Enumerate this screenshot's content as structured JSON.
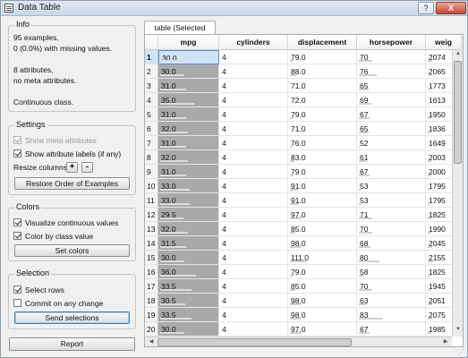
{
  "window": {
    "title": "Data Table",
    "help_label": "?",
    "close_label": "X"
  },
  "info": {
    "title": "Info",
    "lines": [
      "95 examples,",
      "0 (0.0%) with missing values.",
      "8 attributes,",
      "no meta attributes.",
      "Continuous class."
    ]
  },
  "settings": {
    "title": "Settings",
    "show_meta": {
      "label": "Show meta attributes",
      "checked": true,
      "enabled": false
    },
    "show_labels": {
      "label": "Show attribute labels (if any)",
      "checked": true,
      "enabled": true
    },
    "resize_label": "Resize columns:",
    "plus_label": "+",
    "minus_label": "-",
    "restore_label": "Restore Order of Examples"
  },
  "colors": {
    "title": "Colors",
    "visualize": {
      "label": "Visualize continuous values",
      "checked": true
    },
    "color_by_class": {
      "label": "Color by class value",
      "checked": true
    },
    "set_colors_label": "Set colors"
  },
  "selection": {
    "title": "Selection",
    "select_rows": {
      "label": "Select rows",
      "checked": true
    },
    "commit": {
      "label": "Commit on any change",
      "checked": false
    },
    "send_label": "Send selections"
  },
  "report_label": "Report",
  "tab_label": "table (Selected Data)",
  "table": {
    "columns": [
      "mpg",
      "cylinders",
      "displacement",
      "horsepower",
      "weig"
    ],
    "rows": [
      {
        "n": "1",
        "mpg": "30.0",
        "cyl": "4",
        "disp": "79.0",
        "hp": "70",
        "weight": "2074",
        "bars": [
          0.42,
          0.0,
          0.05,
          0.2,
          0.15
        ]
      },
      {
        "n": "2",
        "mpg": "30.0",
        "cyl": "4",
        "disp": "88.0",
        "hp": "76",
        "weight": "2065",
        "bars": [
          0.42,
          0.0,
          0.1,
          0.28,
          0.15
        ]
      },
      {
        "n": "3",
        "mpg": "31.0",
        "cyl": "4",
        "disp": "71.0",
        "hp": "65",
        "weight": "1773",
        "bars": [
          0.45,
          0.0,
          0.0,
          0.15,
          0.05
        ]
      },
      {
        "n": "4",
        "mpg": "35.0",
        "cyl": "4",
        "disp": "72.0",
        "hp": "69",
        "weight": "1613",
        "bars": [
          0.6,
          0.0,
          0.0,
          0.19,
          0.02
        ]
      },
      {
        "n": "5",
        "mpg": "31.0",
        "cyl": "4",
        "disp": "79.0",
        "hp": "67",
        "weight": "1950",
        "bars": [
          0.45,
          0.0,
          0.05,
          0.17,
          0.1
        ]
      },
      {
        "n": "6",
        "mpg": "32.0",
        "cyl": "4",
        "disp": "71.0",
        "hp": "65",
        "weight": "1836",
        "bars": [
          0.48,
          0.0,
          0.0,
          0.15,
          0.07
        ]
      },
      {
        "n": "7",
        "mpg": "31.0",
        "cyl": "4",
        "disp": "76.0",
        "hp": "52",
        "weight": "1649",
        "bars": [
          0.45,
          0.0,
          0.03,
          0.02,
          0.02
        ]
      },
      {
        "n": "8",
        "mpg": "32.0",
        "cyl": "4",
        "disp": "83.0",
        "hp": "61",
        "weight": "2003",
        "bars": [
          0.48,
          0.0,
          0.07,
          0.11,
          0.11
        ]
      },
      {
        "n": "9",
        "mpg": "31.0",
        "cyl": "4",
        "disp": "79.0",
        "hp": "67",
        "weight": "2000",
        "bars": [
          0.45,
          0.0,
          0.05,
          0.17,
          0.11
        ]
      },
      {
        "n": "10",
        "mpg": "33.0",
        "cyl": "4",
        "disp": "91.0",
        "hp": "53",
        "weight": "1795",
        "bars": [
          0.52,
          0.0,
          0.12,
          0.03,
          0.06
        ]
      },
      {
        "n": "11",
        "mpg": "33.0",
        "cyl": "4",
        "disp": "91.0",
        "hp": "53",
        "weight": "1795",
        "bars": [
          0.52,
          0.0,
          0.12,
          0.03,
          0.06
        ]
      },
      {
        "n": "12",
        "mpg": "29.5",
        "cyl": "4",
        "disp": "97.0",
        "hp": "71",
        "weight": "1825",
        "bars": [
          0.4,
          0.0,
          0.16,
          0.21,
          0.07
        ]
      },
      {
        "n": "13",
        "mpg": "32.0",
        "cyl": "4",
        "disp": "85.0",
        "hp": "70",
        "weight": "1990",
        "bars": [
          0.48,
          0.0,
          0.08,
          0.2,
          0.1
        ]
      },
      {
        "n": "14",
        "mpg": "31.5",
        "cyl": "4",
        "disp": "98.0",
        "hp": "68",
        "weight": "2045",
        "bars": [
          0.46,
          0.0,
          0.17,
          0.18,
          0.13
        ]
      },
      {
        "n": "15",
        "mpg": "30.0",
        "cyl": "4",
        "disp": "111.0",
        "hp": "80",
        "weight": "2155",
        "bars": [
          0.42,
          0.0,
          0.25,
          0.32,
          0.17
        ]
      },
      {
        "n": "16",
        "mpg": "36.0",
        "cyl": "4",
        "disp": "79.0",
        "hp": "58",
        "weight": "1825",
        "bars": [
          0.63,
          0.0,
          0.05,
          0.08,
          0.07
        ]
      },
      {
        "n": "17",
        "mpg": "33.5",
        "cyl": "4",
        "disp": "85.0",
        "hp": "70",
        "weight": "1945",
        "bars": [
          0.54,
          0.0,
          0.08,
          0.2,
          0.09
        ]
      },
      {
        "n": "18",
        "mpg": "30.5",
        "cyl": "4",
        "disp": "98.0",
        "hp": "63",
        "weight": "2051",
        "bars": [
          0.43,
          0.0,
          0.17,
          0.13,
          0.13
        ]
      },
      {
        "n": "19",
        "mpg": "33.5",
        "cyl": "4",
        "disp": "98.0",
        "hp": "83",
        "weight": "2075",
        "bars": [
          0.54,
          0.0,
          0.17,
          0.35,
          0.15
        ]
      },
      {
        "n": "20",
        "mpg": "30.0",
        "cyl": "4",
        "disp": "97.0",
        "hp": "67",
        "weight": "1985",
        "bars": [
          0.42,
          0.0,
          0.16,
          0.17,
          0.1
        ]
      }
    ]
  }
}
